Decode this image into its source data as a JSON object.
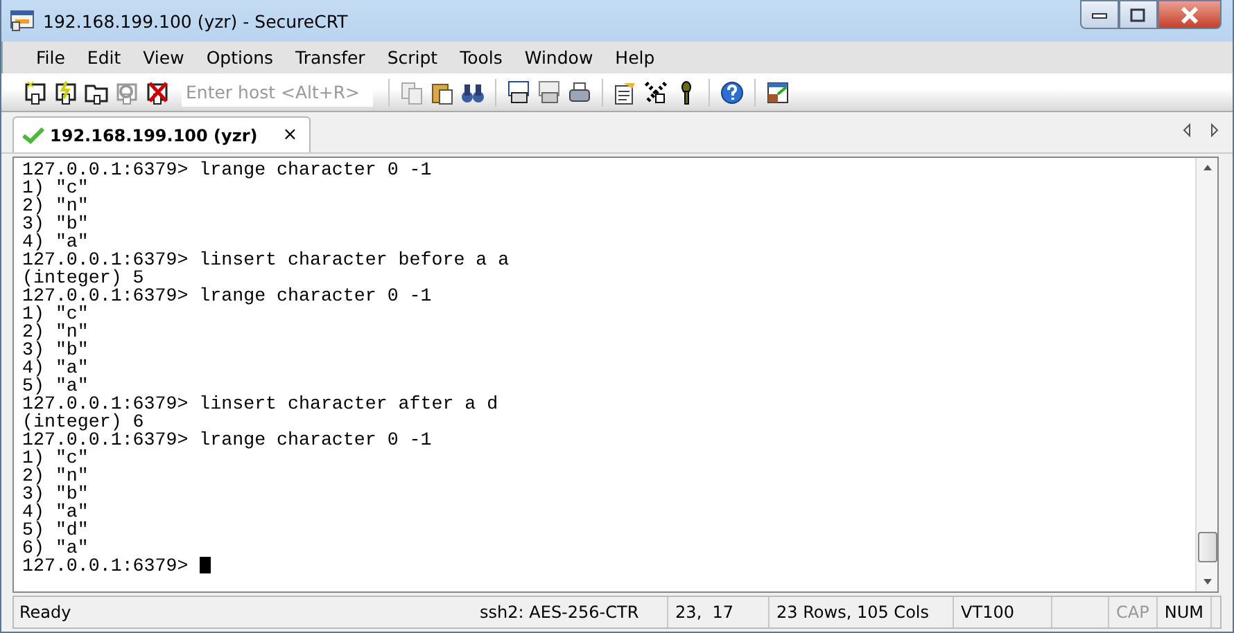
{
  "window": {
    "title": "192.168.199.100 (yzr) - SecureCRT"
  },
  "menu": [
    "File",
    "Edit",
    "View",
    "Options",
    "Transfer",
    "Script",
    "Tools",
    "Window",
    "Help"
  ],
  "toolbar": {
    "host_field": {
      "placeholder": "Enter host <Alt+R>"
    }
  },
  "tabs": [
    {
      "label": "192.168.199.100 (yzr)",
      "selected": true,
      "connected": true,
      "close": "×"
    }
  ],
  "terminal": {
    "lines": [
      "127.0.0.1:6379> lrange character 0 -1",
      "1) \"c\"",
      "2) \"n\"",
      "3) \"b\"",
      "4) \"a\"",
      "127.0.0.1:6379> linsert character before a a",
      "(integer) 5",
      "127.0.0.1:6379> lrange character 0 -1",
      "1) \"c\"",
      "2) \"n\"",
      "3) \"b\"",
      "4) \"a\"",
      "5) \"a\"",
      "127.0.0.1:6379> linsert character after a d",
      "(integer) 6",
      "127.0.0.1:6379> lrange character 0 -1",
      "1) \"c\"",
      "2) \"n\"",
      "3) \"b\"",
      "4) \"a\"",
      "5) \"d\"",
      "6) \"a\"",
      "127.0.0.1:6379> "
    ],
    "cursor": true
  },
  "status_bar": {
    "state": "Ready",
    "cipher": "ssh2: AES-256-CTR",
    "position": "23,  17",
    "size": "23 Rows, 105 Cols",
    "emulation": "VT100",
    "indicators": [
      {
        "label": "CAP",
        "on": false
      },
      {
        "label": "NUM",
        "on": true
      }
    ]
  }
}
